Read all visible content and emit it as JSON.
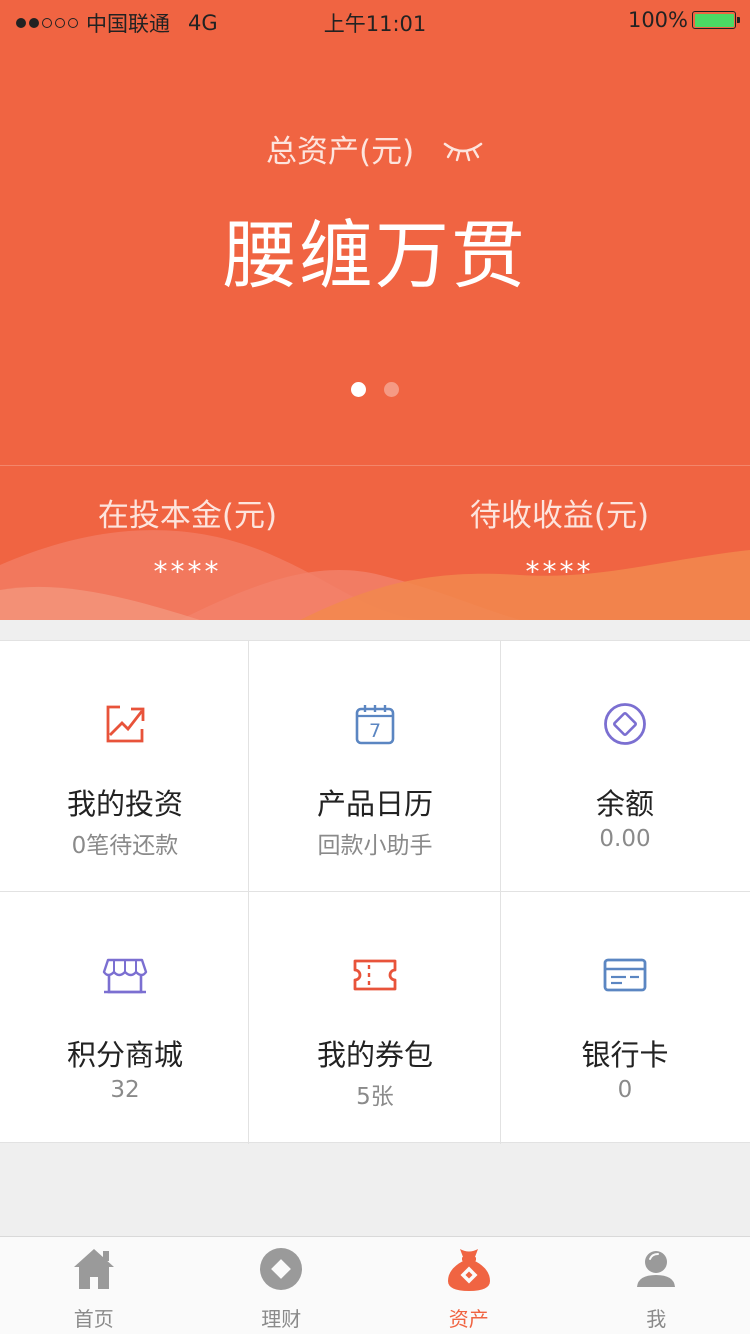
{
  "status_bar": {
    "carrier": "中国联通",
    "network": "4G",
    "time": "上午11:01",
    "battery": "100%",
    "signal_filled": 2,
    "signal_total": 5
  },
  "header": {
    "total_label": "总资产(元)",
    "total_value": "腰缠万贯",
    "pager_count": 2,
    "pager_active": 0,
    "principal_label": "在投本金(元)",
    "principal_value": "****",
    "earnings_label": "待收收益(元)",
    "earnings_value": "****"
  },
  "menu": [
    {
      "title": "我的投资",
      "sub": "0笔待还款",
      "icon": "trend-up-icon",
      "color": "#e8533a"
    },
    {
      "title": "产品日历",
      "sub": "回款小助手",
      "icon": "calendar-icon",
      "color": "#5b86c2",
      "icon_text": "7"
    },
    {
      "title": "余额",
      "sub": "0.00",
      "icon": "balance-icon",
      "color": "#7b6fd1"
    },
    {
      "title": "积分商城",
      "sub": "32",
      "icon": "store-icon",
      "color": "#7b6fd1"
    },
    {
      "title": "我的券包",
      "sub": "5张",
      "icon": "ticket-icon",
      "color": "#e8533a"
    },
    {
      "title": "银行卡",
      "sub": "0",
      "icon": "bank-card-icon",
      "color": "#5b86c2"
    }
  ],
  "tabs": [
    {
      "label": "首页",
      "icon": "home-icon",
      "active": false
    },
    {
      "label": "理财",
      "icon": "finance-icon",
      "active": false
    },
    {
      "label": "资产",
      "icon": "money-bag-icon",
      "active": true
    },
    {
      "label": "我",
      "icon": "user-icon",
      "active": false
    }
  ],
  "colors": {
    "brand": "#f06442",
    "tab_inactive": "#9a9a9a"
  }
}
